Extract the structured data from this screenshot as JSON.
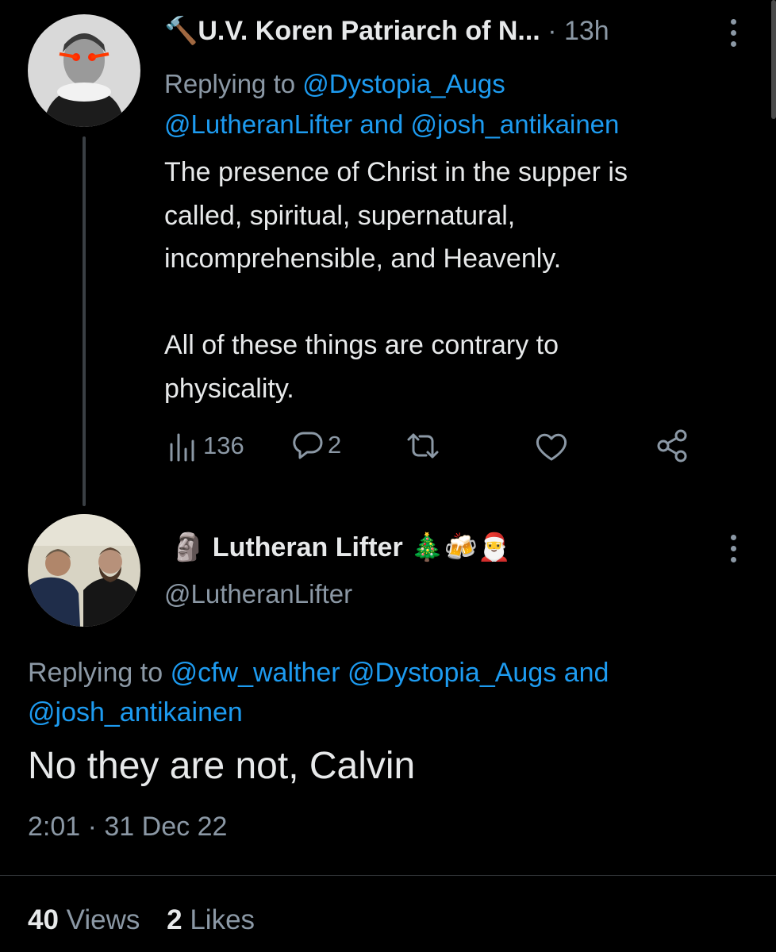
{
  "tweet1": {
    "name_emoji": "🔨",
    "name": "U.V. Koren Patriarch of N...",
    "time": "· 13h",
    "reply_prefix": "Replying to",
    "reply_user1": "@Dystopia_Augs",
    "reply_user2": "@LutheranLifter",
    "reply_and": "and",
    "reply_user3": "@josh_antikainen",
    "body": [
      "The presence of Christ in the supper is",
      "called, spiritual, supernatural,",
      "incomprehensible, and Heavenly.",
      "",
      "All of these things are contrary to",
      "physicality."
    ],
    "views": "136",
    "replies": "2"
  },
  "tweet2": {
    "name_prefix_emoji": "🗿",
    "name": "Lutheran Lifter",
    "name_suffix_emoji": "🎄🍻🎅",
    "handle": "@LutheranLifter",
    "reply_prefix": "Replying to",
    "reply_user1": "@cfw_walther",
    "reply_user2": "@Dystopia_Augs",
    "reply_and": "and",
    "reply_user3": "@josh_antikainen",
    "body": "No they are not, Calvin",
    "timestamp": "2:01 · 31 Dec 22",
    "views_count": "40",
    "views_label": "Views",
    "likes_count": "2",
    "likes_label": "Likes"
  },
  "colors": {
    "background": "#000000",
    "text": "#e7e9ea",
    "muted": "#8b98a5",
    "link": "#1d9bf0"
  },
  "icons": [
    "views-icon",
    "reply-icon",
    "retweet-icon",
    "like-icon",
    "share-icon",
    "more-icon"
  ]
}
